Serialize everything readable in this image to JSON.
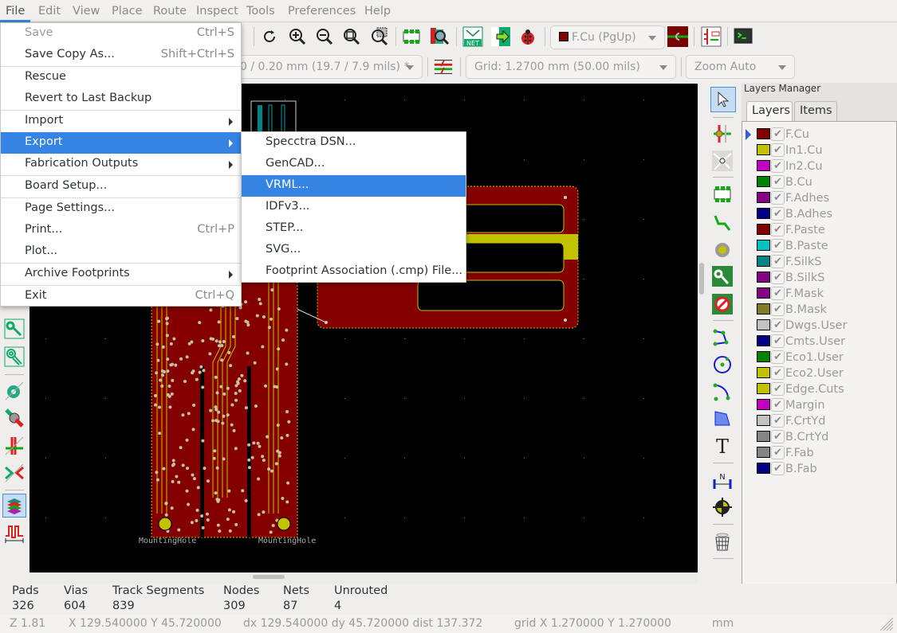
{
  "menubar": {
    "items": [
      "File",
      "Edit",
      "View",
      "Place",
      "Route",
      "Inspect",
      "Tools",
      "Preferences",
      "Help"
    ]
  },
  "toolbar": {
    "track_combo": "0 / 0.20 mm (19.7 / 7.9 mils) *",
    "layer_combo": "F.Cu (PgUp)",
    "layer_color": "#840000",
    "grid_combo": "Grid: 1.2700 mm (50.00 mils)",
    "zoom_combo": "Zoom Auto"
  },
  "file_menu": {
    "items": [
      {
        "label": "Save",
        "shortcut": "Ctrl+S",
        "disabled": true
      },
      {
        "label": "Save Copy As...",
        "shortcut": "Shift+Ctrl+S"
      },
      {
        "label": "Rescue",
        "shortcut": ""
      },
      {
        "label": "Revert to Last Backup",
        "shortcut": ""
      },
      {
        "label": "Import",
        "shortcut": "",
        "submenu": true
      },
      {
        "label": "Export",
        "shortcut": "",
        "submenu": true,
        "highlighted": true
      },
      {
        "label": "Fabrication Outputs",
        "shortcut": "",
        "submenu": true
      },
      {
        "label": "Board Setup...",
        "shortcut": ""
      },
      {
        "label": "Page Settings...",
        "shortcut": ""
      },
      {
        "label": "Print...",
        "shortcut": "Ctrl+P"
      },
      {
        "label": "Plot...",
        "shortcut": ""
      },
      {
        "label": "Archive Footprints",
        "shortcut": "",
        "submenu": true
      },
      {
        "label": "Exit",
        "shortcut": "Ctrl+Q"
      }
    ]
  },
  "export_menu": {
    "items": [
      {
        "label": "Specctra DSN..."
      },
      {
        "label": "GenCAD..."
      },
      {
        "label": "VRML...",
        "highlighted": true
      },
      {
        "label": "IDFv3..."
      },
      {
        "label": "STEP..."
      },
      {
        "label": "SVG..."
      },
      {
        "label": "Footprint Association (.cmp) File..."
      }
    ]
  },
  "canvas": {
    "labels": [
      "MountingHole",
      "MountingHole"
    ]
  },
  "layers_manager": {
    "title": "Layers Manager",
    "tabs": [
      "Layers",
      "Items"
    ],
    "active_layer": "F.Cu",
    "layers": [
      {
        "name": "F.Cu",
        "color": "#840000"
      },
      {
        "name": "In1.Cu",
        "color": "#c2c200"
      },
      {
        "name": "In2.Cu",
        "color": "#c200c2"
      },
      {
        "name": "B.Cu",
        "color": "#008400"
      },
      {
        "name": "F.Adhes",
        "color": "#840084"
      },
      {
        "name": "B.Adhes",
        "color": "#000084"
      },
      {
        "name": "F.Paste",
        "color": "#840000"
      },
      {
        "name": "B.Paste",
        "color": "#00c2c2"
      },
      {
        "name": "F.SilkS",
        "color": "#008484"
      },
      {
        "name": "B.SilkS",
        "color": "#840084"
      },
      {
        "name": "F.Mask",
        "color": "#840084"
      },
      {
        "name": "B.Mask",
        "color": "#847a24"
      },
      {
        "name": "Dwgs.User",
        "color": "#c2c2c2"
      },
      {
        "name": "Cmts.User",
        "color": "#000084"
      },
      {
        "name": "Eco1.User",
        "color": "#008400"
      },
      {
        "name": "Eco2.User",
        "color": "#c2c200"
      },
      {
        "name": "Edge.Cuts",
        "color": "#c2c200"
      },
      {
        "name": "Margin",
        "color": "#c200c2"
      },
      {
        "name": "F.CrtYd",
        "color": "#c2c2c2"
      },
      {
        "name": "B.CrtYd",
        "color": "#848484"
      },
      {
        "name": "F.Fab",
        "color": "#848484"
      },
      {
        "name": "B.Fab",
        "color": "#000084"
      }
    ]
  },
  "stats": [
    {
      "label": "Pads",
      "value": "326"
    },
    {
      "label": "Vias",
      "value": "604"
    },
    {
      "label": "Track Segments",
      "value": "839"
    },
    {
      "label": "Nodes",
      "value": "309"
    },
    {
      "label": "Nets",
      "value": "87"
    },
    {
      "label": "Unrouted",
      "value": "4"
    }
  ],
  "statusbar": {
    "zoom": "Z 1.81",
    "xy": "X 129.540000  Y 45.720000",
    "delta": "dx 129.540000  dy 45.720000  dist 137.372",
    "grid": "grid X 1.270000  Y 1.270000",
    "units": "mm"
  }
}
